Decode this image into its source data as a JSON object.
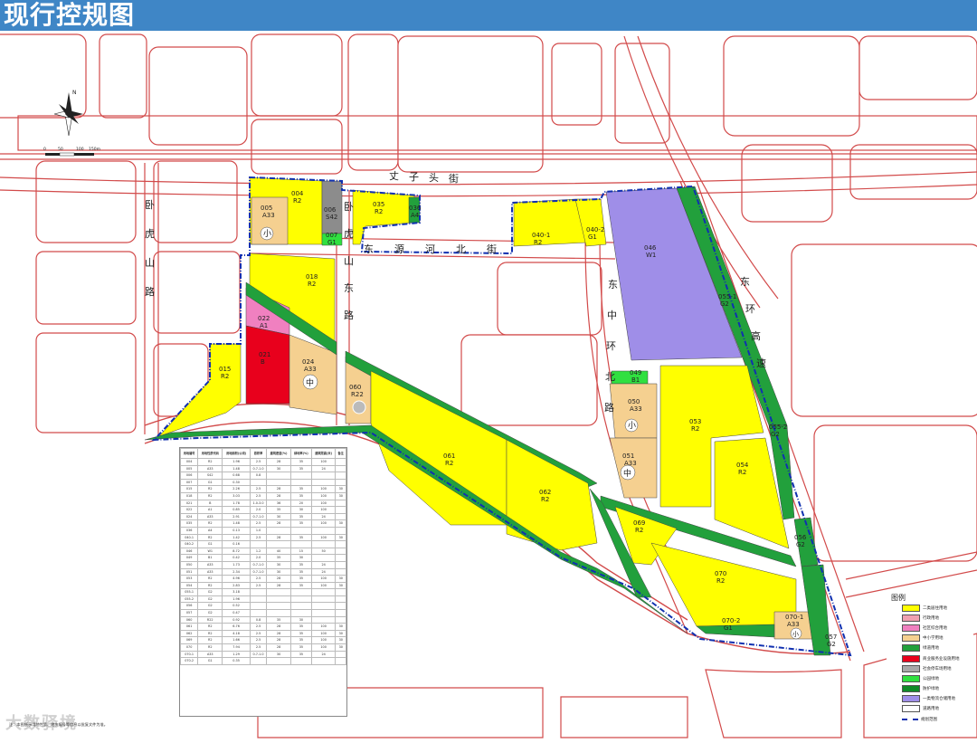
{
  "title": "现行控规图",
  "north_label": "N",
  "scale_labels": [
    "0",
    "50",
    "100",
    "150m"
  ],
  "streets": {
    "zhangzitou": "丈子头街",
    "wohu_road": "卧虎山路",
    "wohu_east": "卧虎山东路",
    "dongyuanhe_north": "东源河北街",
    "dongzhonghuan_north": "东中环北路",
    "donghuan_expressway": "东环高速"
  },
  "legend": {
    "title": "图例",
    "items": [
      {
        "label": "二类居住用地",
        "color": "#ffff00"
      },
      {
        "label": "行政用地",
        "color": "#f0a0b0"
      },
      {
        "label": "社区综合用地",
        "color": "#f080c0"
      },
      {
        "label": "中小学用地",
        "color": "#f5d090"
      },
      {
        "label": "绿道用地",
        "color": "#22a03c"
      },
      {
        "label": "商业服务业设施用地",
        "color": "#e8001c"
      },
      {
        "label": "社会停车场用地",
        "color": "#a8a8a8"
      },
      {
        "label": "公园绿地",
        "color": "#30e040"
      },
      {
        "label": "防护绿地",
        "color": "#108a28"
      },
      {
        "label": "一类物流仓储用地",
        "color": "#9f8ee8"
      },
      {
        "label": "道路用地",
        "color": "#ffffff"
      },
      {
        "label": "规划范围",
        "color": "#1030b0"
      }
    ]
  },
  "plots": [
    {
      "id": "004",
      "code": "R2"
    },
    {
      "id": "005",
      "code": "A33"
    },
    {
      "id": "006",
      "code": "S42"
    },
    {
      "id": "007",
      "code": "G1"
    },
    {
      "id": "035",
      "code": "R2"
    },
    {
      "id": "036",
      "code": "A4"
    },
    {
      "id": "040-1",
      "code": "R2"
    },
    {
      "id": "040-2",
      "code": "G1"
    },
    {
      "id": "046",
      "code": "W1"
    },
    {
      "id": "018",
      "code": "R2"
    },
    {
      "id": "022",
      "code": "A1"
    },
    {
      "id": "021",
      "code": "B"
    },
    {
      "id": "024",
      "code": "A33"
    },
    {
      "id": "015",
      "code": "R2"
    },
    {
      "id": "060",
      "code": "R22"
    },
    {
      "id": "061",
      "code": "R2"
    },
    {
      "id": "062",
      "code": "R2"
    },
    {
      "id": "049",
      "code": "B1"
    },
    {
      "id": "050",
      "code": "A33"
    },
    {
      "id": "051",
      "code": "A33"
    },
    {
      "id": "053",
      "code": "R2"
    },
    {
      "id": "054",
      "code": "R2"
    },
    {
      "id": "055-1",
      "code": "G2"
    },
    {
      "id": "055-2",
      "code": "G2"
    },
    {
      "id": "069",
      "code": "R2"
    },
    {
      "id": "070",
      "code": "R2"
    },
    {
      "id": "070-1",
      "code": "A33"
    },
    {
      "id": "070-2",
      "code": "G1"
    },
    {
      "id": "056",
      "code": "G2"
    },
    {
      "id": "057",
      "code": "G2"
    }
  ],
  "school_labels": {
    "xiao": "小",
    "zhong": "中"
  },
  "table": {
    "headers": [
      "用地编号",
      "用地性质代码",
      "用地面积(公顷)",
      "容积率",
      "建筑密度(%)",
      "绿地率(%)",
      "建筑限高(米)",
      "备注"
    ],
    "rows": [
      [
        "004",
        "R2",
        "1.96",
        "2.5",
        "28",
        "35",
        "100",
        ""
      ],
      [
        "005",
        "A33",
        "1.48",
        "0.7-1.0",
        "30",
        "35",
        "24",
        ""
      ],
      [
        "006",
        "S42",
        "0.68",
        "0.8",
        "",
        "",
        "",
        ""
      ],
      [
        "007",
        "G1",
        "0.30",
        "",
        "",
        "",
        "",
        ""
      ],
      [
        "015",
        "R2",
        "2.26",
        "2.5",
        "28",
        "35",
        "100",
        "30"
      ],
      [
        "018",
        "R2",
        "3.03",
        "2.5",
        "28",
        "35",
        "100",
        "30"
      ],
      [
        "021",
        "B",
        "1.78",
        "1.0-3.0",
        "36",
        "20",
        "100",
        ""
      ],
      [
        "022",
        "A1",
        "0.85",
        "2.0",
        "35",
        "30",
        "100",
        ""
      ],
      [
        "024",
        "A33",
        "2.91",
        "0.7-1.0",
        "30",
        "35",
        "24",
        ""
      ],
      [
        "035",
        "R2",
        "1.48",
        "2.5",
        "28",
        "35",
        "100",
        "30"
      ],
      [
        "036",
        "A4",
        "0.13",
        "1.0",
        "",
        "",
        "",
        ""
      ],
      [
        "040-1",
        "R2",
        "1.42",
        "2.5",
        "28",
        "35",
        "100",
        "30"
      ],
      [
        "040-2",
        "G1",
        "0.16",
        "",
        "",
        "",
        "",
        ""
      ],
      [
        "046",
        "W1",
        "8.72",
        "1.2",
        "40",
        "15",
        "50",
        ""
      ],
      [
        "049",
        "B1",
        "0.42",
        "2.0",
        "35",
        "30",
        "",
        ""
      ],
      [
        "050",
        "A33",
        "1.73",
        "0.7-1.0",
        "30",
        "35",
        "24",
        ""
      ],
      [
        "051",
        "A33",
        "2.34",
        "0.7-1.0",
        "30",
        "35",
        "24",
        ""
      ],
      [
        "053",
        "R2",
        "4.96",
        "2.5",
        "28",
        "35",
        "100",
        "30"
      ],
      [
        "054",
        "R2",
        "2.83",
        "2.5",
        "28",
        "35",
        "100",
        "30"
      ],
      [
        "055-1",
        "G2",
        "3.18",
        "",
        "",
        "",
        "",
        ""
      ],
      [
        "055-2",
        "G2",
        "1.96",
        "",
        "",
        "",
        "",
        ""
      ],
      [
        "056",
        "G2",
        "0.52",
        "",
        "",
        "",
        "",
        ""
      ],
      [
        "057",
        "G2",
        "0.47",
        "",
        "",
        "",
        "",
        ""
      ],
      [
        "060",
        "R22",
        "0.92",
        "0.8",
        "35",
        "30",
        "",
        ""
      ],
      [
        "061",
        "R2",
        "6.76",
        "2.5",
        "28",
        "35",
        "100",
        "30"
      ],
      [
        "062",
        "R2",
        "4.18",
        "2.5",
        "28",
        "35",
        "100",
        "30"
      ],
      [
        "069",
        "R2",
        "1.66",
        "2.5",
        "28",
        "35",
        "100",
        "30"
      ],
      [
        "070",
        "R2",
        "7.94",
        "2.5",
        "28",
        "35",
        "100",
        "30"
      ],
      [
        "070-1",
        "A33",
        "1.29",
        "0.7-1.0",
        "30",
        "35",
        "24",
        ""
      ],
      [
        "070-2",
        "G1",
        "0.35",
        "",
        "",
        "",
        "",
        ""
      ]
    ]
  },
  "watermark": "大数驿境",
  "footnote": "注：本图所示用地性质、地块编号等信息以批复文件为准。"
}
